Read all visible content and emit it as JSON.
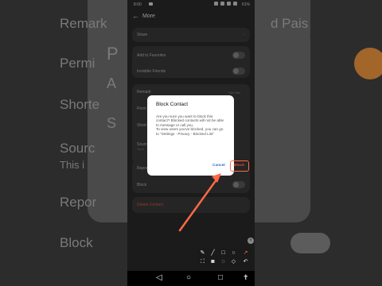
{
  "status_bar": {
    "time": "8:00",
    "battery": "61%"
  },
  "app_bar": {
    "title": "More"
  },
  "bg": {
    "row1": "Remark",
    "row1_value": "d Pais",
    "row2": "Permi",
    "row3": "Shorte",
    "row3b": "S",
    "row4": "Sourc",
    "row4_sub": "This i",
    "row5": "Repor",
    "row6": "Block",
    "left_a": "A",
    "left_b": "P"
  },
  "menu": {
    "share": "Share",
    "favorites": "Add to Favorites",
    "invisible": "Invisible Friends",
    "remark": "Remark",
    "remark_value": "Md Pais",
    "permissions": "Perm",
    "shortcut": "Short",
    "source": "Sourc",
    "source_sub": "You A",
    "report": "Repor",
    "block": "Block",
    "delete": "Delete Contact"
  },
  "dialog": {
    "title": "Block Contact",
    "body1": "Are you sure you want to block this contact? Blocked contacts will not be able to message or call you.",
    "body2": "To view users you've blocked, you can go to \"Settings - Privacy - Blocked List\"",
    "cancel": "Cancel",
    "block": "Block"
  },
  "annotation": {
    "accent": "#ff6a45"
  }
}
